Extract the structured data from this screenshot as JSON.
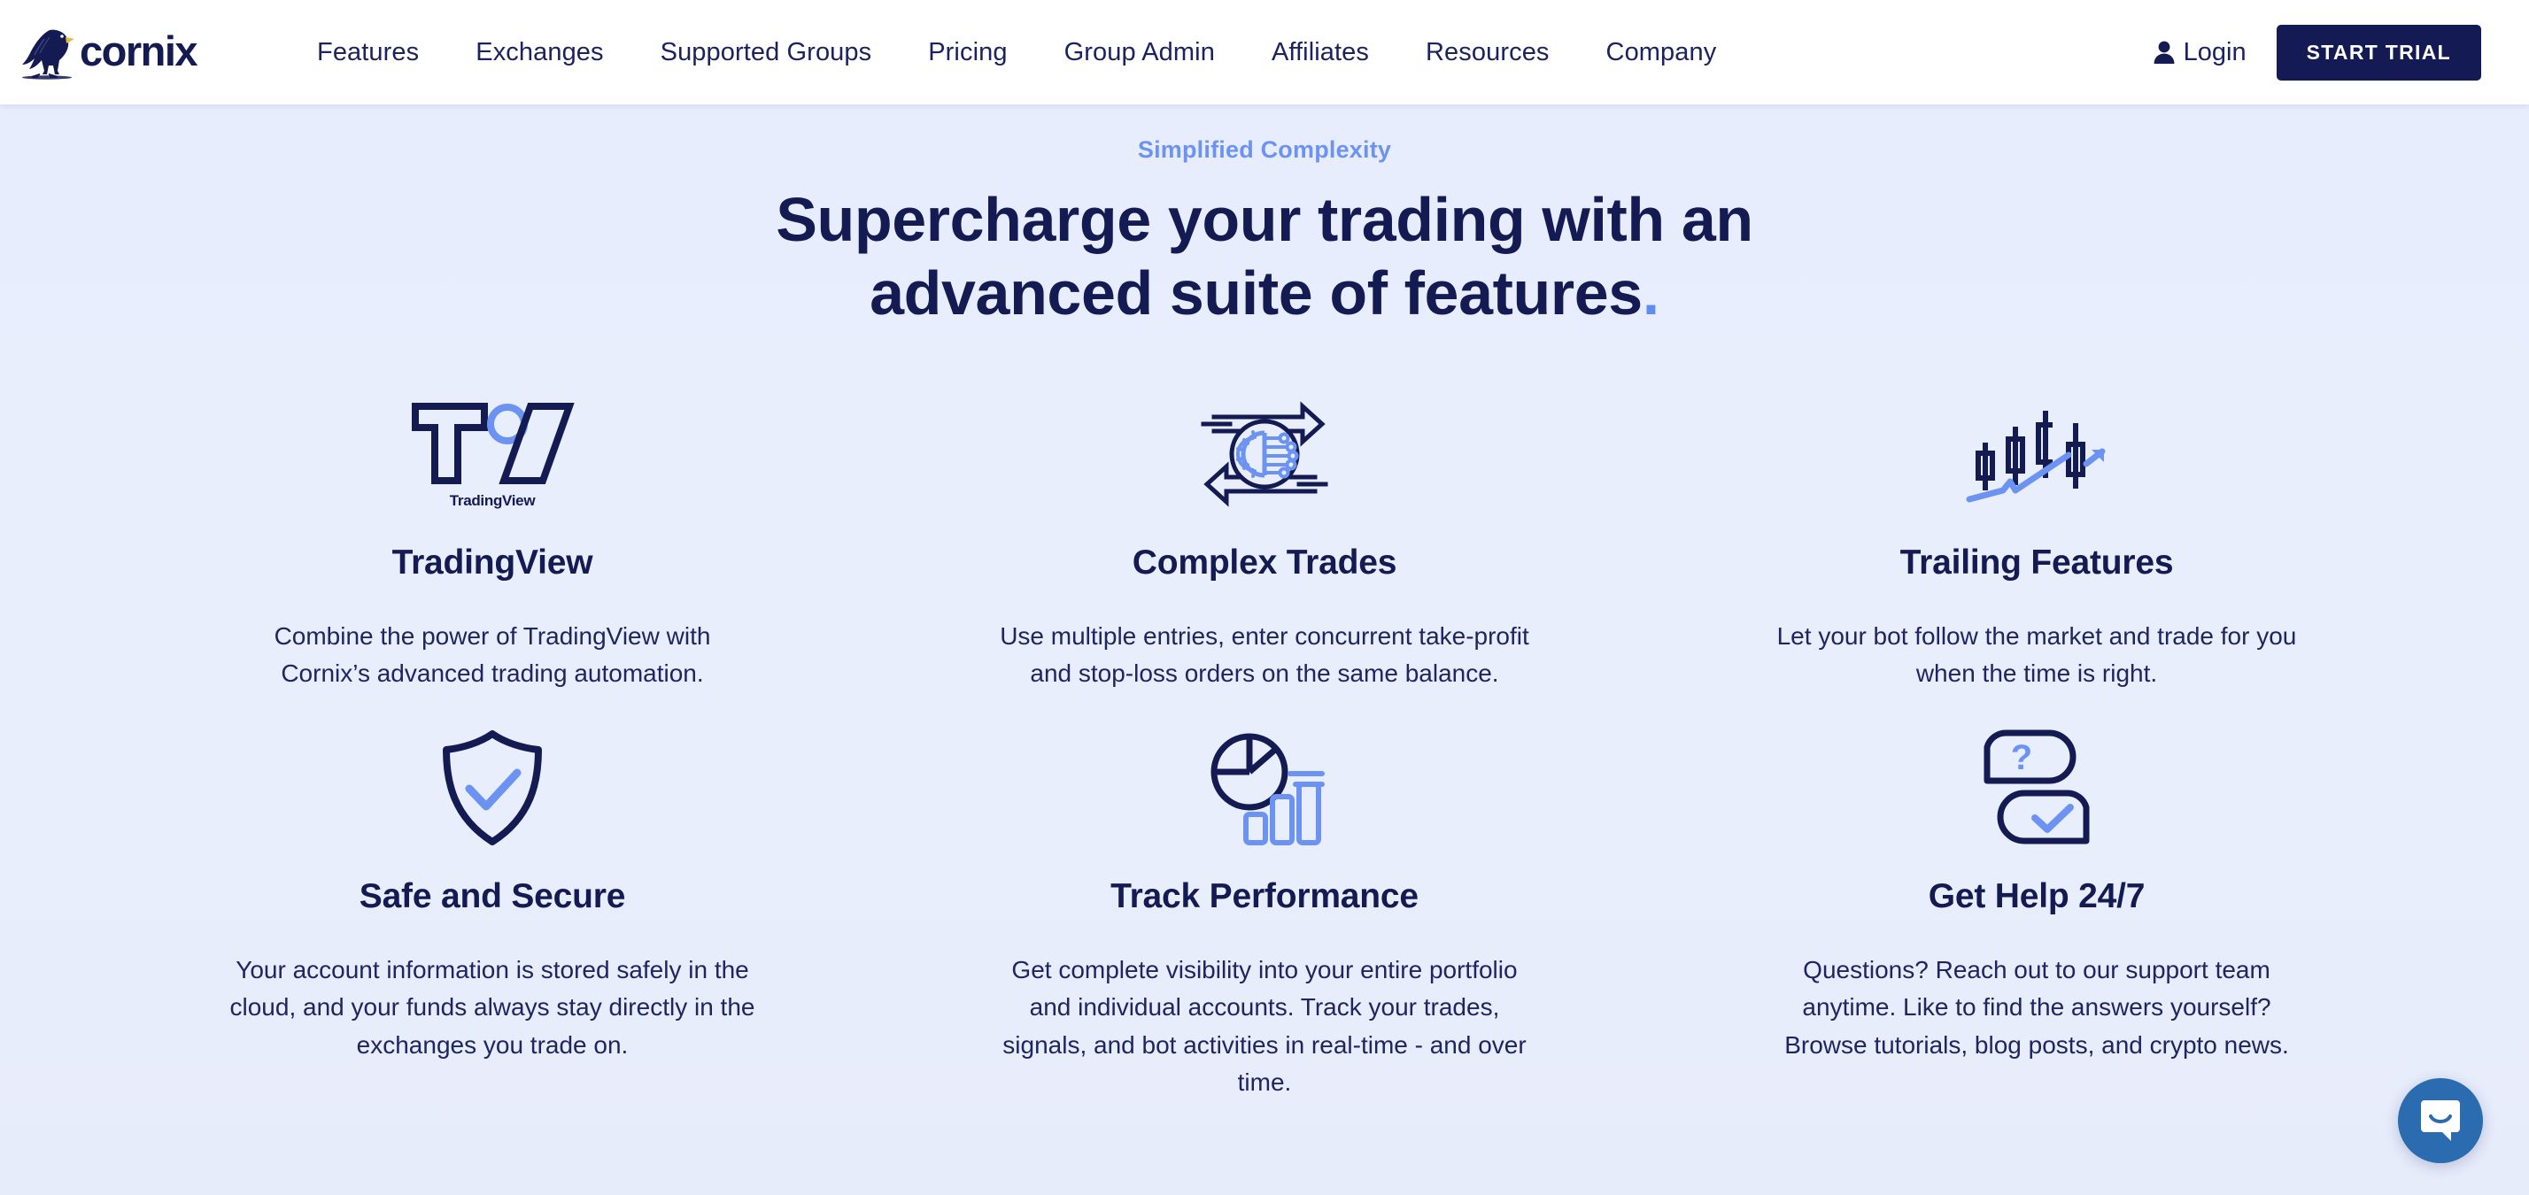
{
  "nav": {
    "logo_text": "cornix",
    "links": [
      {
        "label": "Features"
      },
      {
        "label": "Exchanges"
      },
      {
        "label": "Supported Groups"
      },
      {
        "label": "Pricing"
      },
      {
        "label": "Group Admin"
      },
      {
        "label": "Affiliates"
      },
      {
        "label": "Resources"
      },
      {
        "label": "Company"
      }
    ],
    "login_label": "Login",
    "trial_label": "START TRIAL"
  },
  "hero": {
    "eyebrow": "Simplified Complexity",
    "headline_line1": "Supercharge your trading with an",
    "headline_line2": "advanced suite of features",
    "headline_dot": "."
  },
  "features": [
    {
      "icon": "tradingview-logo-icon",
      "icon_caption": "TradingView",
      "title": "TradingView",
      "description": "Combine the power of TradingView with Cornix’s advanced trading automation."
    },
    {
      "icon": "gear-circuit-arrows-icon",
      "title": "Complex Trades",
      "description": "Use multiple entries, enter concurrent take-profit and stop-loss orders on the same balance."
    },
    {
      "icon": "candlestick-trend-icon",
      "title": "Trailing Features",
      "description": "Let your bot follow the market and trade for you when the time is right."
    },
    {
      "icon": "shield-check-icon",
      "title": "Safe and Secure",
      "description": "Your account information is stored safely in the cloud, and your funds always stay directly in the exchanges you trade on."
    },
    {
      "icon": "pie-bar-chart-icon",
      "title": "Track Performance",
      "description": "Get complete visibility into your entire portfolio and individual accounts. Track your trades, signals, and bot activities in real-time - and over time."
    },
    {
      "icon": "chat-question-check-icon",
      "title": "Get Help 24/7",
      "description": "Questions? Reach out to our support team anytime. Like to find the answers yourself? Browse tutorials, blog posts, and crypto news."
    }
  ],
  "widget": {
    "icon": "intercom-chat-icon"
  },
  "colors": {
    "brand_navy": "#141a52",
    "accent_blue": "#5f8cf0",
    "eyebrow_blue": "#6d93f2",
    "page_background": "#e9eefc",
    "nav_background": "#ffffff",
    "intercom_blue": "#2b6cb0"
  }
}
